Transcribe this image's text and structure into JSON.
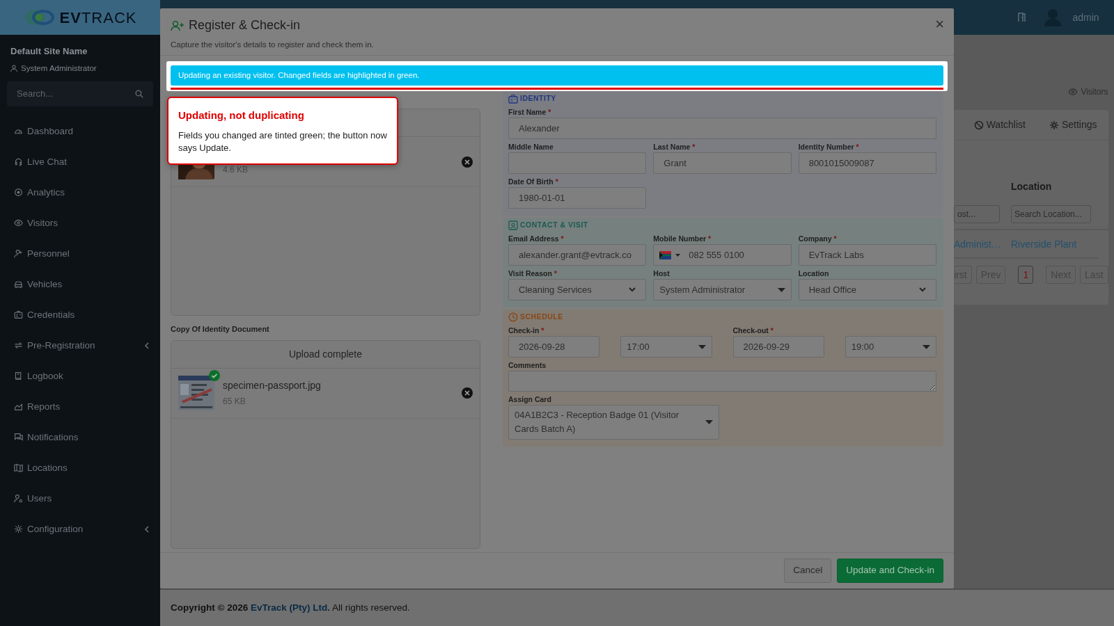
{
  "sidebar": {
    "logo": "**EV**TRACK",
    "site_name": "Default Site Name",
    "user": "System Administrator",
    "search": {
      "placeholder": "Search..."
    },
    "items": [
      {
        "label": "Dashboard",
        "expandable": false
      },
      {
        "label": "Live Chat",
        "expandable": false
      },
      {
        "label": "Analytics",
        "expandable": false
      },
      {
        "label": "Visitors",
        "expandable": false
      },
      {
        "label": "Personnel",
        "expandable": false
      },
      {
        "label": "Vehicles",
        "expandable": false
      },
      {
        "label": "Credentials",
        "expandable": false
      },
      {
        "label": "Pre-Registration",
        "expandable": true
      },
      {
        "label": "Logbook",
        "expandable": false
      },
      {
        "label": "Reports",
        "expandable": false
      },
      {
        "label": "Notifications",
        "expandable": false
      },
      {
        "label": "Locations",
        "expandable": false
      },
      {
        "label": "Users",
        "expandable": false
      },
      {
        "label": "Configuration",
        "expandable": true
      }
    ]
  },
  "topbar": {
    "user": "admin"
  },
  "page": {
    "breadcrumb": "Visitors",
    "tabs": [
      {
        "label": "Watchlist"
      },
      {
        "label": "Settings"
      }
    ],
    "filter_label": "Location",
    "filters": [
      {
        "placeholder": "ost..."
      },
      {
        "placeholder": "Search Location..."
      }
    ],
    "row": [
      "Administ…",
      "Riverside Plant"
    ],
    "pagination": [
      {
        "label": "irst",
        "selected": false
      },
      {
        "label": "Prev",
        "selected": false
      },
      {
        "label": "1",
        "selected": true
      },
      {
        "label": "Next",
        "selected": false
      },
      {
        "label": "Last",
        "selected": false
      }
    ]
  },
  "modal": {
    "title": "Register & Check-in",
    "subtitle": "Capture the visitor's details to register and check them in.",
    "close": "×",
    "alert": "Updating an existing visitor. Changed fields are highlighted in green.",
    "popover": {
      "title": "Updating, not duplicating",
      "body": "Fields you changed are tinted green; the button now says Update."
    },
    "photo": {
      "size": "4.6 KB"
    },
    "document": {
      "label": "Copy Of Identity Document",
      "header": "Upload complete",
      "file_name": "specimen-passport.jpg",
      "size": "65 KB",
      "uploaded": true
    },
    "sections": [
      {
        "kind": "identity",
        "title": "IDENTITY",
        "rows": [
          [
            {
              "label": "First Name",
              "required_mark": "*",
              "kind": "text",
              "value": "Alexander",
              "wide": true
            }
          ],
          [
            {
              "label": "Middle Name",
              "kind": "text"
            },
            {
              "label": "Last Name",
              "required_mark": "*",
              "kind": "text",
              "value": "Grant"
            },
            {
              "label": "Identity Number",
              "required_mark": "*",
              "kind": "text",
              "value": "8001015009087"
            }
          ],
          [
            {
              "label": "Date Of Birth",
              "required_mark": "*",
              "kind": "text",
              "value": "1980-01-01"
            }
          ]
        ]
      },
      {
        "kind": "contact",
        "title": "CONTACT & VISIT",
        "rows": [
          [
            {
              "label": "Email Address",
              "required_mark": "*",
              "kind": "text",
              "value": "alexander.grant@evtrack.co"
            },
            {
              "label": "Mobile Number",
              "required_mark": "*",
              "kind": "phone",
              "value": "082 555 0100"
            },
            {
              "label": "Company",
              "required_mark": "*",
              "kind": "text",
              "value": "EvTrack Labs"
            }
          ],
          [
            {
              "label": "Visit Reason",
              "required_mark": "*",
              "kind": "select",
              "value": "Cleaning Services"
            },
            {
              "label": "Host",
              "kind": "dropdown",
              "value": "System Administrator"
            },
            {
              "label": "Location",
              "kind": "select",
              "value": "Head Office"
            }
          ]
        ]
      },
      {
        "kind": "schedule",
        "title": "SCHEDULE",
        "rows": [
          [
            {
              "label": "Check-in",
              "required_mark": "*",
              "kind": "text",
              "value": "2026-09-28"
            },
            {
              "kind": "dropdown",
              "value": "17:00"
            },
            {
              "label": "Check-out",
              "required_mark": "*",
              "kind": "text",
              "value": "2026-09-29"
            },
            {
              "kind": "dropdown",
              "value": "19:00"
            }
          ],
          [
            {
              "label": "Comments",
              "kind": "textarea"
            }
          ],
          [
            {
              "label": "Assign Card",
              "kind": "card",
              "value": "04A1B2C3 - Reception Badge 01 (Visitor Cards Batch A)"
            }
          ]
        ]
      }
    ],
    "buttons": [
      {
        "label": "Cancel",
        "kind": "secondary"
      },
      {
        "label": "Update and Check-in",
        "kind": "primary"
      }
    ]
  },
  "footer": {
    "copyright": "Copyright © 2026",
    "company": "EvTrack (Pty) Ltd.",
    "rights": "All rights reserved."
  }
}
